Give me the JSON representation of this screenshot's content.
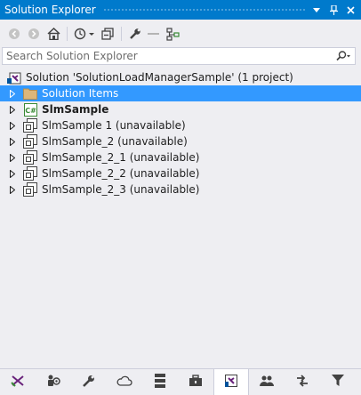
{
  "window": {
    "title": "Solution Explorer"
  },
  "search": {
    "placeholder": "Search Solution Explorer"
  },
  "tree": {
    "solution_label": "Solution 'SolutionLoadManagerSample' (1 project)",
    "items": [
      {
        "label": "Solution Items",
        "icon": "folder-icon",
        "selected": true
      },
      {
        "label": "SlmSample",
        "icon": "csharp-project-icon",
        "bold": true
      },
      {
        "label": "SlmSample 1 (unavailable)",
        "icon": "unavailable-project-icon"
      },
      {
        "label": "SlmSample_2 (unavailable)",
        "icon": "unavailable-project-icon"
      },
      {
        "label": "SlmSample_2_1 (unavailable)",
        "icon": "unavailable-project-icon"
      },
      {
        "label": "SlmSample_2_2 (unavailable)",
        "icon": "unavailable-project-icon"
      },
      {
        "label": "SlmSample_2_3 (unavailable)",
        "icon": "unavailable-project-icon"
      }
    ]
  },
  "colors": {
    "accent": "#007acc",
    "selection": "#3399ff",
    "background": "#eeeef2"
  }
}
